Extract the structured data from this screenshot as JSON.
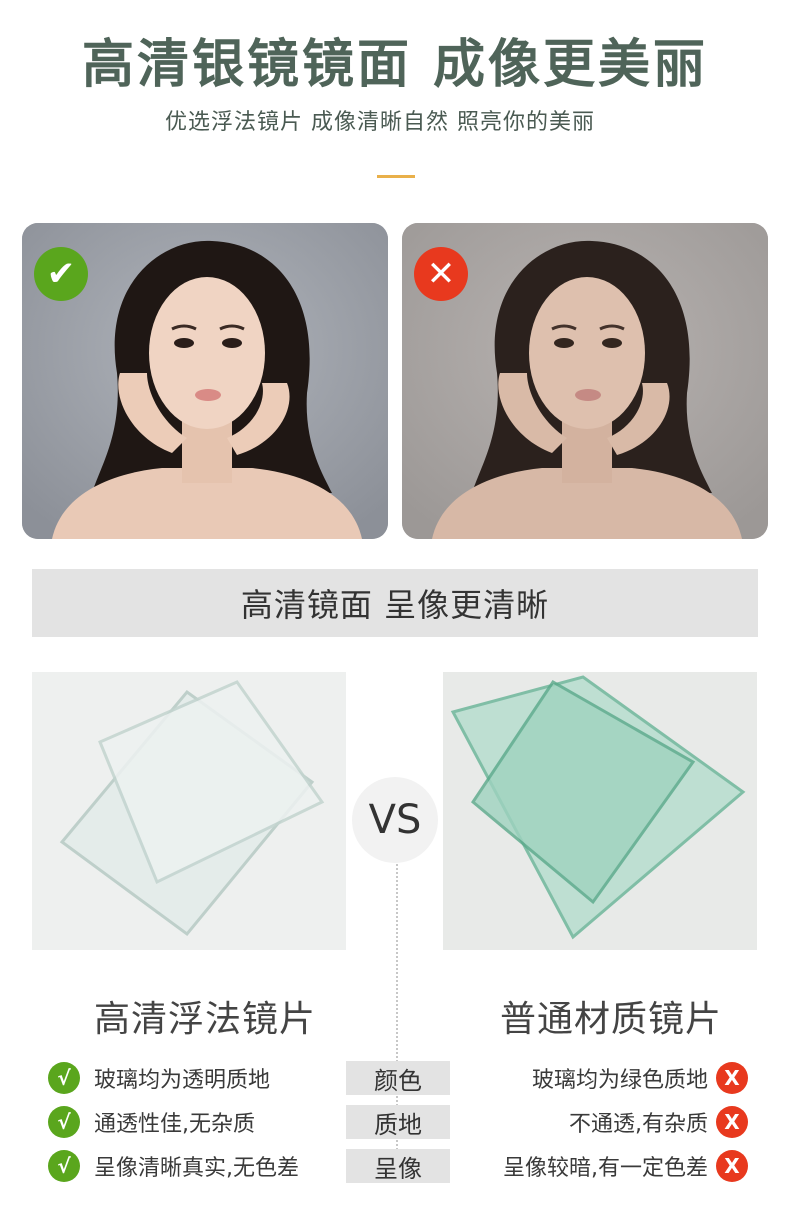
{
  "header": {
    "title": "高清银镜镜面 成像更美丽",
    "subtitle": "优选浮法镜片 成像清晰自然 照亮你的美丽"
  },
  "portraits": {
    "good_badge": "✔",
    "bad_badge": "✕"
  },
  "banner": {
    "text": "高清镜面 呈像更清晰"
  },
  "comparison": {
    "vs_label": "VS",
    "left_title": "高清浮法镜片",
    "right_title": "普通材质镜片",
    "rows": [
      {
        "category": "颜色",
        "left": "玻璃均为透明质地",
        "right": "玻璃均为绿色质地"
      },
      {
        "category": "质地",
        "left": "通透性佳,无杂质",
        "right": "不通透,有杂质"
      },
      {
        "category": "呈像",
        "left": "呈像清晰真实,无色差",
        "right": "呈像较暗,有一定色差"
      }
    ],
    "ok_mark": "√",
    "no_mark": "X"
  },
  "colors": {
    "title": "#4f6459",
    "accent": "#e9b04a",
    "ok_green": "#5aa61d",
    "no_red": "#e8391e",
    "clear_glass": "#dfe8e6",
    "green_glass": "#a9d8c6"
  }
}
